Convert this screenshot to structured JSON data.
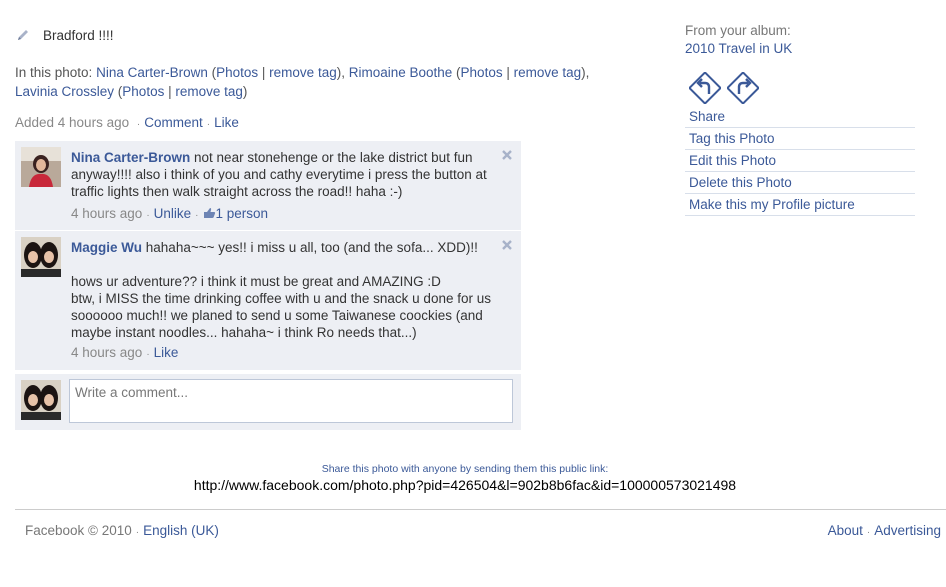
{
  "caption": {
    "text": "Bradford !!!!"
  },
  "in_photo": {
    "prefix": "In this photo:",
    "people": [
      {
        "name": "Nina Carter-Brown",
        "photos": "Photos",
        "remove": "remove tag"
      },
      {
        "name": "Rimoaine Boothe",
        "photos": "Photos",
        "remove": "remove tag"
      },
      {
        "name": "Lavinia Crossley",
        "photos": "Photos",
        "remove": "remove tag"
      }
    ]
  },
  "added": {
    "time": "Added 4 hours ago",
    "comment": "Comment",
    "like": "Like"
  },
  "comments": [
    {
      "name": "Nina Carter-Brown",
      "text": "not near stonehenge or the lake district but fun anyway!!!! also i think of you and cathy everytime i press the button at traffic lights then walk straight across the road!! haha :-)",
      "time": "4 hours ago",
      "action": "Unlike",
      "likes": "1 person"
    },
    {
      "name": "Maggie Wu",
      "text_first": "hahaha~~~ yes!! i miss u all, too (and the sofa... XDD)!!",
      "text_rest": "hows ur adventure?? i think it must be great and AMAZING :D\nbtw, i MISS the time drinking coffee with u and the snack u done for us soooooo much!! we planed to send u some Taiwanese coockies (and maybe instant noodles... hahaha~ i think Ro needs that...)",
      "time": "4 hours ago",
      "action": "Like"
    }
  ],
  "new_comment": {
    "placeholder": "Write a comment..."
  },
  "share": {
    "note": "Share this photo with anyone by sending them this public link:",
    "url": "http://www.facebook.com/photo.php?pid=426504&l=902b8b6fac&id=100000573021498"
  },
  "album": {
    "label": "From your album:",
    "name": "2010 Travel in UK"
  },
  "actions": [
    "Share",
    "Tag this Photo",
    "Edit this Photo",
    "Delete this Photo",
    "Make this my Profile picture"
  ],
  "footer": {
    "copyright": "Facebook © 2010",
    "language": "English (UK)",
    "about": "About",
    "advertising": "Advertising"
  },
  "colors": {
    "link": "#3b5998",
    "comment_bg": "#edeff4"
  }
}
